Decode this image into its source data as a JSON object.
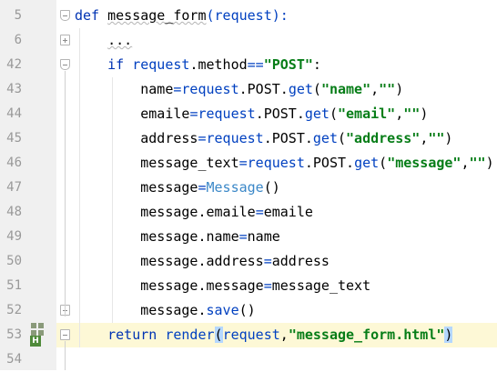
{
  "editor": {
    "lines": [
      {
        "num": "5",
        "tokens": [
          [
            "kw",
            "def "
          ],
          [
            "fn",
            "message_form"
          ],
          [
            "op",
            "("
          ],
          [
            "pm",
            "request"
          ],
          [
            "op",
            "):"
          ]
        ]
      },
      {
        "num": "6",
        "tokens": [
          [
            "sp",
            "    "
          ],
          [
            "dots",
            "..."
          ]
        ]
      },
      {
        "num": "42",
        "tokens": [
          [
            "sp",
            "    "
          ],
          [
            "kw",
            "if "
          ],
          [
            "pm",
            "request"
          ],
          [
            "dim",
            "."
          ],
          [
            "fn",
            "method"
          ],
          [
            "op",
            "=="
          ],
          [
            "str",
            "\"POST\""
          ],
          [
            "dim",
            ":"
          ]
        ]
      },
      {
        "num": "43",
        "tokens": [
          [
            "sp",
            "        "
          ],
          [
            "fn",
            "name"
          ],
          [
            "op",
            "="
          ],
          [
            "pm",
            "request"
          ],
          [
            "dim",
            "."
          ],
          [
            "fn",
            "POST"
          ],
          [
            "dim",
            "."
          ],
          [
            "pm",
            "get"
          ],
          [
            "dim",
            "("
          ],
          [
            "str",
            "\"name\""
          ],
          [
            "dim",
            ","
          ],
          [
            "str",
            "\"\""
          ],
          [
            "dim",
            ")"
          ]
        ]
      },
      {
        "num": "44",
        "tokens": [
          [
            "sp",
            "        "
          ],
          [
            "fn",
            "emaile"
          ],
          [
            "op",
            "="
          ],
          [
            "pm",
            "request"
          ],
          [
            "dim",
            "."
          ],
          [
            "fn",
            "POST"
          ],
          [
            "dim",
            "."
          ],
          [
            "pm",
            "get"
          ],
          [
            "dim",
            "("
          ],
          [
            "str",
            "\"email\""
          ],
          [
            "dim",
            ","
          ],
          [
            "str",
            "\"\""
          ],
          [
            "dim",
            ")"
          ]
        ]
      },
      {
        "num": "45",
        "tokens": [
          [
            "sp",
            "        "
          ],
          [
            "fn",
            "address"
          ],
          [
            "op",
            "="
          ],
          [
            "pm",
            "request"
          ],
          [
            "dim",
            "."
          ],
          [
            "fn",
            "POST"
          ],
          [
            "dim",
            "."
          ],
          [
            "pm",
            "get"
          ],
          [
            "dim",
            "("
          ],
          [
            "str",
            "\"address\""
          ],
          [
            "dim",
            ","
          ],
          [
            "str",
            "\"\""
          ],
          [
            "dim",
            ")"
          ]
        ]
      },
      {
        "num": "46",
        "tokens": [
          [
            "sp",
            "        "
          ],
          [
            "fn",
            "message_text"
          ],
          [
            "op",
            "="
          ],
          [
            "pm",
            "request"
          ],
          [
            "dim",
            "."
          ],
          [
            "fn",
            "POST"
          ],
          [
            "dim",
            "."
          ],
          [
            "pm",
            "get"
          ],
          [
            "dim",
            "("
          ],
          [
            "str",
            "\"message\""
          ],
          [
            "dim",
            ","
          ],
          [
            "str",
            "\"\""
          ],
          [
            "dim",
            ")"
          ]
        ]
      },
      {
        "num": "47",
        "tokens": [
          [
            "sp",
            "        "
          ],
          [
            "fn",
            "message"
          ],
          [
            "op",
            "="
          ],
          [
            "cls",
            "Message"
          ],
          [
            "dim",
            "()"
          ]
        ]
      },
      {
        "num": "48",
        "tokens": [
          [
            "sp",
            "        "
          ],
          [
            "fn",
            "message"
          ],
          [
            "dim",
            "."
          ],
          [
            "fn",
            "emaile"
          ],
          [
            "op",
            "="
          ],
          [
            "fn",
            "emaile"
          ]
        ]
      },
      {
        "num": "49",
        "tokens": [
          [
            "sp",
            "        "
          ],
          [
            "fn",
            "message"
          ],
          [
            "dim",
            "."
          ],
          [
            "fn",
            "name"
          ],
          [
            "op",
            "="
          ],
          [
            "fn",
            "name"
          ]
        ]
      },
      {
        "num": "50",
        "tokens": [
          [
            "sp",
            "        "
          ],
          [
            "fn",
            "message"
          ],
          [
            "dim",
            "."
          ],
          [
            "fn",
            "address"
          ],
          [
            "op",
            "="
          ],
          [
            "fn",
            "address"
          ]
        ]
      },
      {
        "num": "51",
        "tokens": [
          [
            "sp",
            "        "
          ],
          [
            "fn",
            "message"
          ],
          [
            "dim",
            "."
          ],
          [
            "fn",
            "message"
          ],
          [
            "op",
            "="
          ],
          [
            "fn",
            "message_text"
          ]
        ]
      },
      {
        "num": "52",
        "tokens": [
          [
            "sp",
            "        "
          ],
          [
            "fn",
            "message"
          ],
          [
            "dim",
            "."
          ],
          [
            "pm",
            "save"
          ],
          [
            "dim",
            "()"
          ]
        ]
      },
      {
        "num": "53",
        "tokens": [
          [
            "sp",
            "    "
          ],
          [
            "kw",
            "return "
          ],
          [
            "pm",
            "render"
          ],
          [
            "hl",
            "("
          ],
          [
            "pm",
            "request"
          ],
          [
            "dim",
            ","
          ],
          [
            "str",
            "\"message_form.html\""
          ],
          [
            "hl",
            ")"
          ]
        ]
      },
      {
        "num": "54",
        "tokens": []
      }
    ]
  },
  "gutter": {
    "badge_label": "H"
  }
}
